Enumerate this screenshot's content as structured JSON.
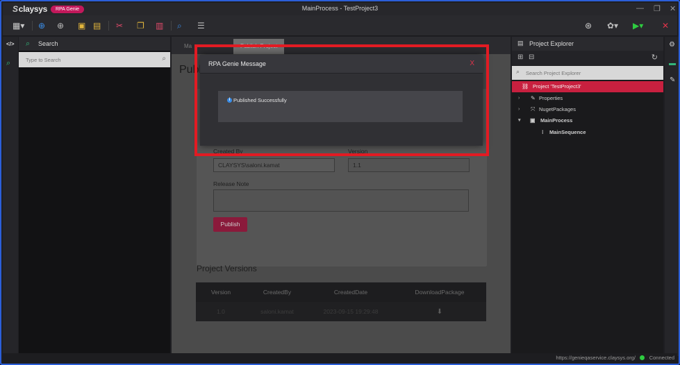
{
  "app": {
    "logo_symbol": "S",
    "logo_text": "claysys",
    "badge": "RPA Genie",
    "window_title": "MainProcess - TestProject3",
    "win_controls": [
      "—",
      "❐",
      "✕"
    ]
  },
  "colors": {
    "accent": "#c2185b",
    "highlight_border": "#e21b23",
    "selection": "#c8203f",
    "info": "#3a8de8",
    "connected": "#2ecc40"
  },
  "toolbar": {
    "icons": [
      {
        "name": "apps-grid-icon",
        "glyph": "▦▾",
        "color": "#c9c9c9"
      },
      {
        "name": "add-circle-icon",
        "glyph": "⊕",
        "color": "#3a8de8"
      },
      {
        "name": "add-circle-gray-icon",
        "glyph": "⊕",
        "color": "#bcbcbc"
      },
      {
        "name": "save-icon",
        "glyph": "▣",
        "color": "#e0b43c"
      },
      {
        "name": "save-all-icon",
        "glyph": "▤",
        "color": "#e0b43c"
      },
      {
        "name": "cut-icon",
        "glyph": "✂",
        "color": "#e04a6a"
      },
      {
        "name": "copy-icon",
        "glyph": "❐",
        "color": "#e0b43c"
      },
      {
        "name": "paste-icon",
        "glyph": "▥",
        "color": "#e04a6a"
      },
      {
        "name": "search-icon",
        "glyph": "⌕",
        "color": "#3a8de8"
      },
      {
        "name": "list-icon",
        "glyph": "☰",
        "color": "#bcbcbc"
      }
    ],
    "right_icons": [
      {
        "name": "steering-icon",
        "glyph": "⊛",
        "color": "#cfcfcf"
      },
      {
        "name": "settings-dropdown-icon",
        "glyph": "✿▾",
        "color": "#bcbcbc"
      },
      {
        "name": "run-dropdown-icon",
        "glyph": "▶▾",
        "color": "#2ecc40"
      },
      {
        "name": "stop-icon",
        "glyph": "✕",
        "color": "#e0334a"
      }
    ]
  },
  "left_strip": {
    "code_icon": "</>",
    "search_icon": "⌕"
  },
  "left_panel": {
    "title": "Search",
    "search_icon": "⌕",
    "placeholder": "Type to Search"
  },
  "center": {
    "tabs": [
      {
        "label": "Ma",
        "active": false
      },
      {
        "label": "Publish Project",
        "active": true
      }
    ],
    "page_title": "Publi",
    "created_by_label": "Created By",
    "created_by_value": "CLAYSYS\\saloni.kamat",
    "version_label": "Version",
    "version_value": "1.1",
    "release_note_label": "Release Note",
    "publish_label": "Publish",
    "versions_title": "Project Versions",
    "table": {
      "headers": [
        "Version",
        "CreatedBy",
        "CreatedDate",
        "DownloadPackage"
      ],
      "rows": [
        {
          "version": "1.0",
          "created_by": "saloni.kamat",
          "created_date": "2023-09-15 19:29:48",
          "download_icon": "⬇"
        }
      ]
    }
  },
  "dialog": {
    "title": "RPA Genie Message",
    "close": "X",
    "info_icon": "i",
    "message": "Published Successfully"
  },
  "right_panel": {
    "title": "Project Explorer",
    "header_icon": "▤",
    "expand_icon": "⊞",
    "collapse_icon": "⊟",
    "refresh_icon": "↻",
    "search_icon": "⌕",
    "search_placeholder": "Search Project Explorer",
    "tree": [
      {
        "label": "Project 'TestProject3'",
        "icon": "⛓",
        "arrow": "",
        "selected": true,
        "bold": false
      },
      {
        "label": "Properties",
        "icon": "✎",
        "arrow": "›",
        "selected": false,
        "bold": false
      },
      {
        "label": "NugetPackages",
        "icon": "⤧",
        "arrow": "›",
        "selected": false,
        "bold": false
      },
      {
        "label": "MainProcess",
        "icon": "▣",
        "arrow": "▾",
        "selected": false,
        "bold": true
      },
      {
        "label": "MainSequence",
        "icon": "⁝",
        "arrow": "",
        "selected": false,
        "bold": true
      }
    ]
  },
  "right_strip": {
    "settings_icon": "⚙",
    "panel_icon": "▬",
    "edit_icon": "✎"
  },
  "status": {
    "url": "https://genieqaservice.claysys.org/",
    "connection": "Connected"
  }
}
